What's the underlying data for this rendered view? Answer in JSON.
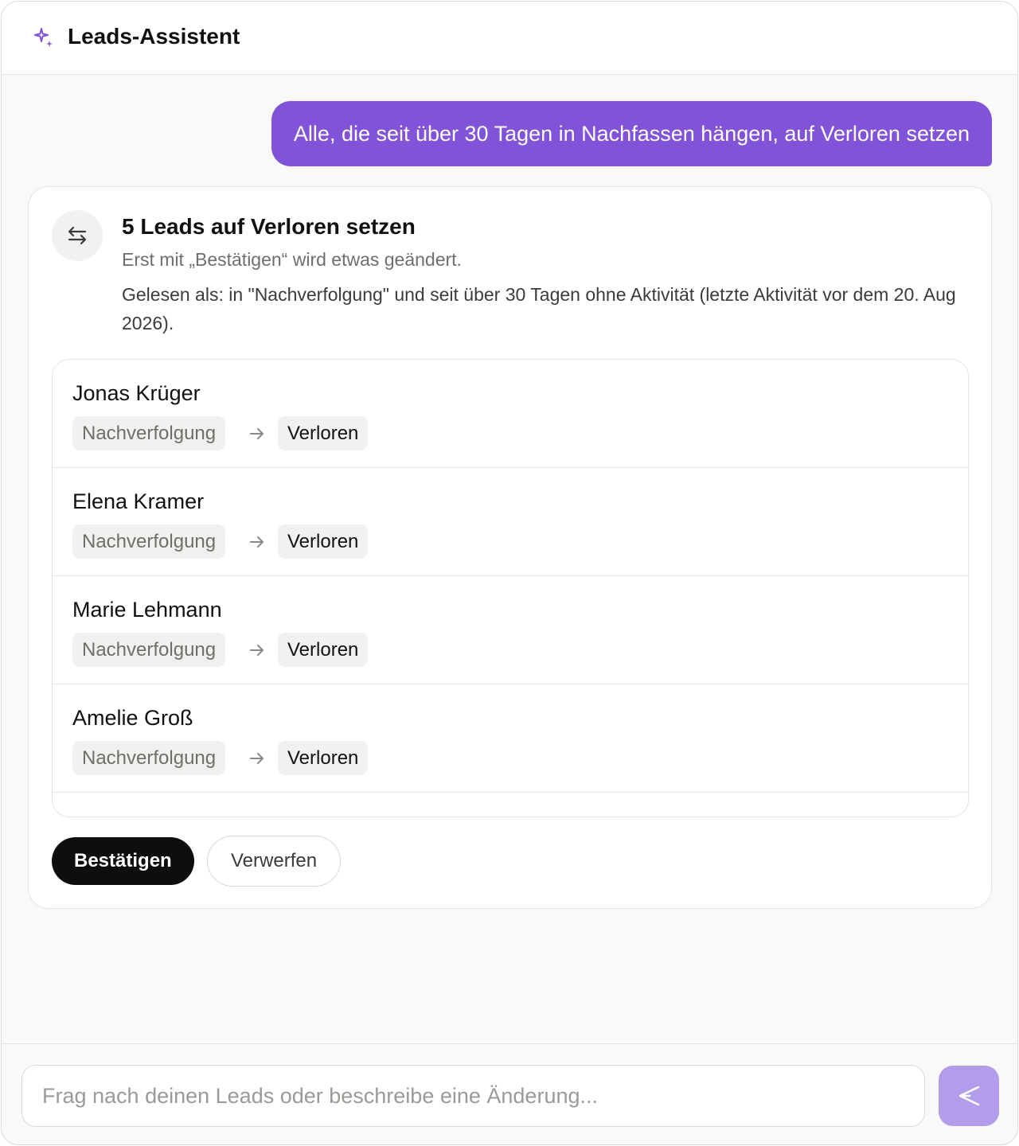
{
  "header": {
    "title": "Leads-Assistent",
    "icon": "sparkle-icon",
    "icon_color": "#8053d9"
  },
  "chat": {
    "user_message": "Alle, die seit über 30 Tagen in Nachfassen hängen, auf Verloren setzen"
  },
  "action_card": {
    "icon": "swap-arrows-icon",
    "title": "5 Leads auf Verloren setzen",
    "subtitle": "Erst mit „Bestätigen“ wird etwas geändert.",
    "description": "Gelesen als: in \"Nachverfolgung\" und seit über 30 Tagen ohne Aktivität (letzte Aktivität vor dem 20. Aug 2026).",
    "leads": [
      {
        "name": "Jonas Krüger",
        "from": "Nachverfolgung",
        "to": "Verloren"
      },
      {
        "name": "Elena Kramer",
        "from": "Nachverfolgung",
        "to": "Verloren"
      },
      {
        "name": "Marie Lehmann",
        "from": "Nachverfolgung",
        "to": "Verloren"
      },
      {
        "name": "Amelie Groß",
        "from": "Nachverfolgung",
        "to": "Verloren"
      }
    ],
    "confirm_label": "Bestätigen",
    "discard_label": "Verwerfen"
  },
  "composer": {
    "placeholder": "Frag nach deinen Leads oder beschreibe eine Änderung...",
    "value": "",
    "send_icon": "send-icon",
    "send_color": "#b39ce9"
  }
}
